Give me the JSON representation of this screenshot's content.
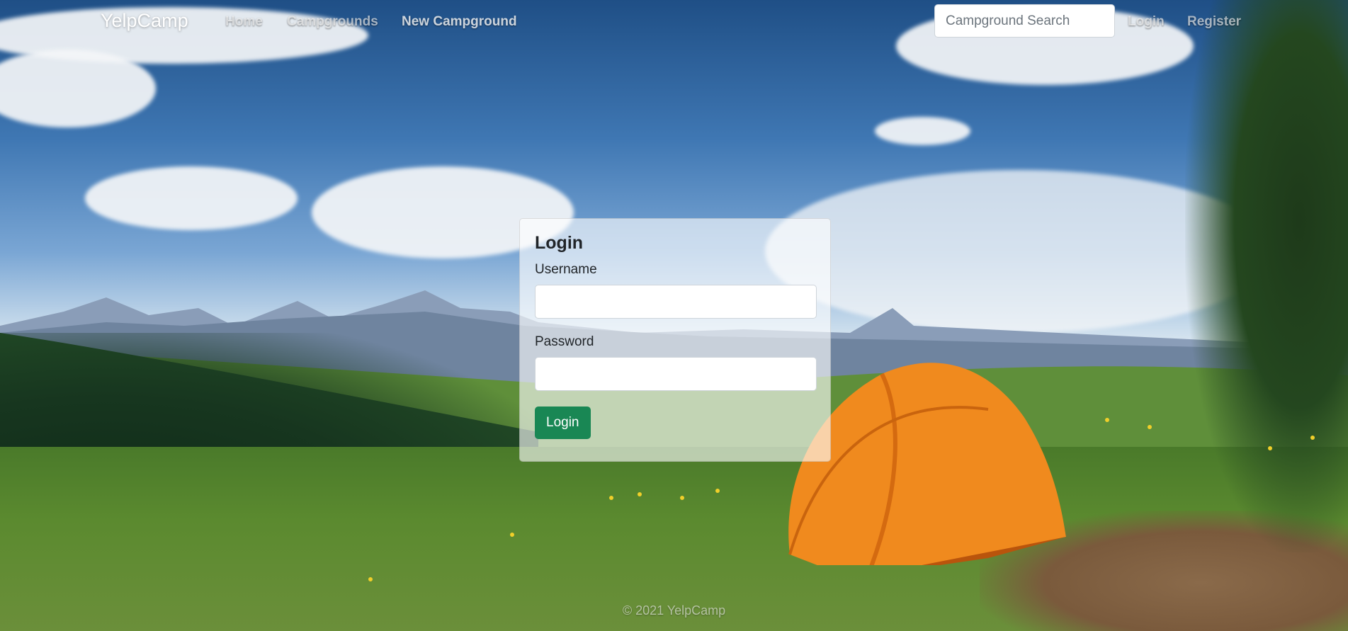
{
  "navbar": {
    "brand": "YelpCamp",
    "links": {
      "home": "Home",
      "campgrounds": "Campgrounds",
      "new_campground": "New Campground",
      "login": "Login",
      "register": "Register"
    },
    "search": {
      "placeholder": "Campground Search",
      "value": ""
    }
  },
  "login_card": {
    "title": "Login",
    "username_label": "Username",
    "password_label": "Password",
    "username_value": "",
    "password_value": "",
    "submit_label": "Login",
    "submit_color": "#198754"
  },
  "footer": {
    "text": "© 2021 YelpCamp"
  }
}
